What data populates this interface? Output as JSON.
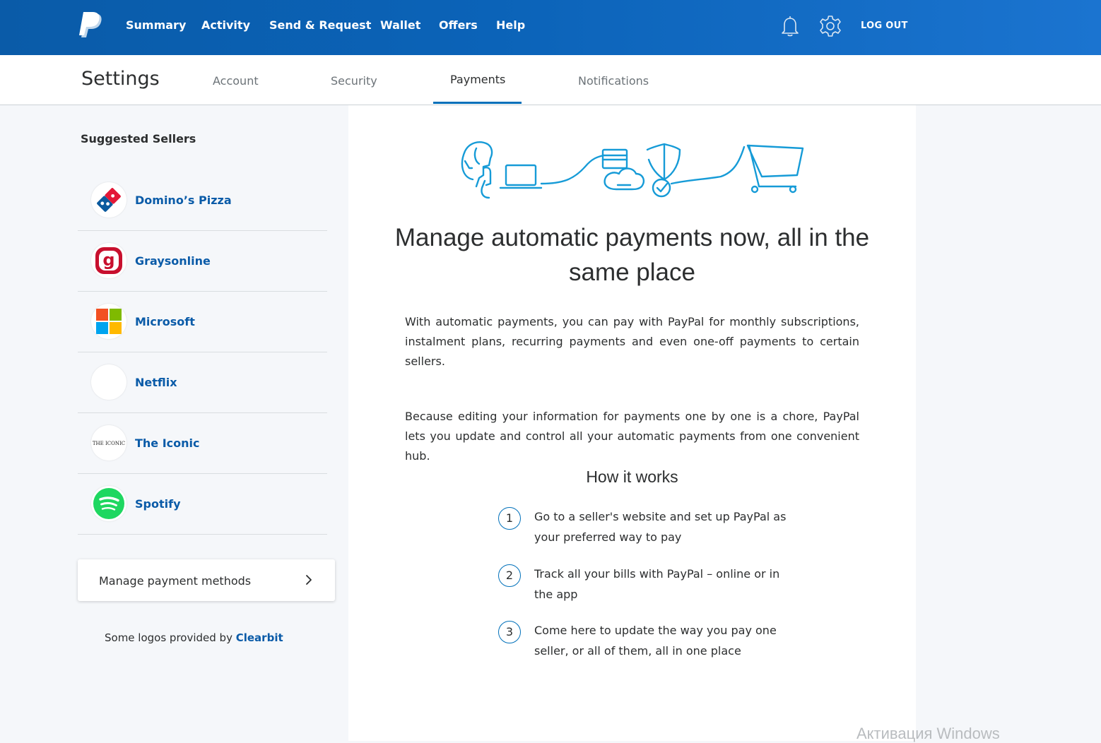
{
  "nav": {
    "items": [
      "Summary",
      "Activity",
      "Send & Request",
      "Wallet",
      "Offers",
      "Help"
    ],
    "logout": "LOG OUT"
  },
  "settings": {
    "title": "Settings",
    "tabs": [
      "Account",
      "Security",
      "Payments",
      "Notifications"
    ],
    "active_tab": "Payments"
  },
  "sidebar": {
    "heading": "Suggested Sellers",
    "sellers": [
      {
        "name": "Domino’s Pizza",
        "logo": "dominos-logo"
      },
      {
        "name": "Graysonline",
        "logo": "graysonline-logo"
      },
      {
        "name": "Microsoft",
        "logo": "microsoft-logo"
      },
      {
        "name": "Netflix",
        "logo": "netflix-logo"
      },
      {
        "name": "The Iconic",
        "logo": "the-iconic-logo",
        "logo_text": "THE ICONIC"
      },
      {
        "name": "Spotify",
        "logo": "spotify-logo"
      }
    ],
    "manage_label": "Manage payment methods",
    "clearbit_prefix": "Some logos provided by ",
    "clearbit_link": "Clearbit"
  },
  "main": {
    "headline": "Manage automatic payments now, all in the same place",
    "para1": "With automatic payments, you can pay with PayPal for monthly subscriptions, instalment plans, recurring payments and even one-off payments to certain sellers.",
    "para2": "Because editing your information for payments one by one is a chore, PayPal lets you update and control all your automatic payments from one convenient hub.",
    "how_title": "How it works",
    "steps": [
      {
        "num": "1",
        "text": "Go to a seller's website and set up PayPal as your preferred way to pay"
      },
      {
        "num": "2",
        "text": "Track all your bills with PayPal – online or in the app"
      },
      {
        "num": "3",
        "text": "Come here to update the way you pay one seller, or all of them, all in one place"
      }
    ]
  },
  "watermark": "Активация Windows",
  "colors": {
    "brand_blue": "#0a5ba8",
    "accent": "#0070ba",
    "text": "#2c2e2f",
    "muted": "#6c7378"
  }
}
